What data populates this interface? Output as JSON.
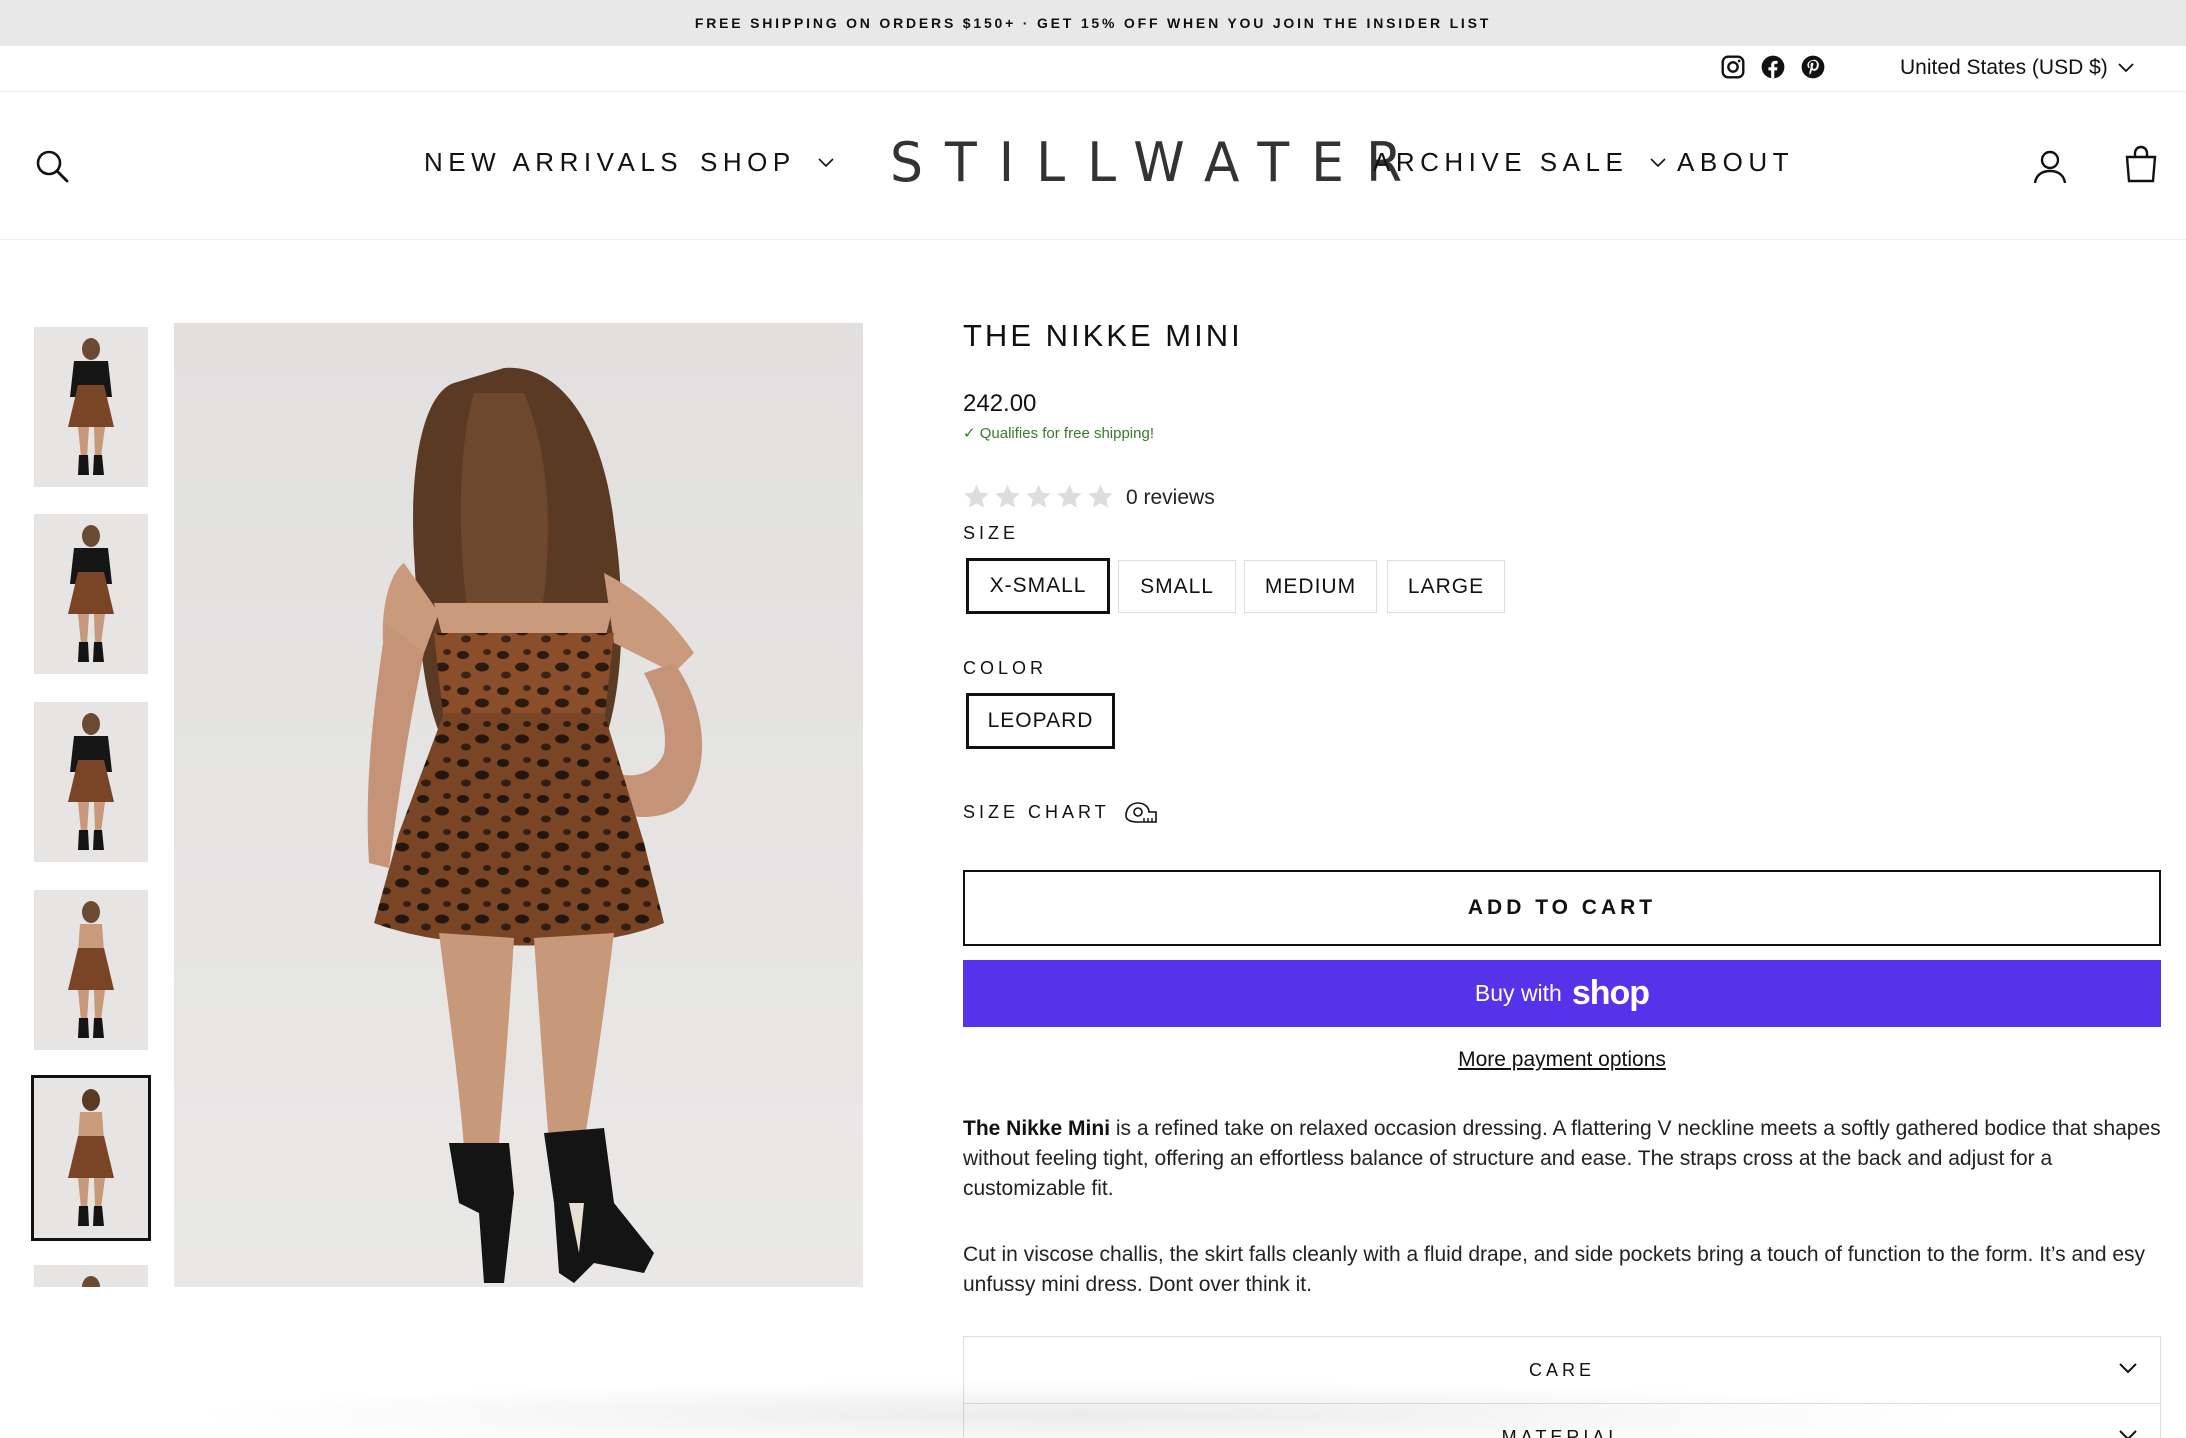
{
  "announcement": "FREE SHIPPING ON ORDERS $150+ · GET 15% OFF WHEN YOU JOIN THE INSIDER LIST",
  "utility": {
    "social": [
      "instagram-icon",
      "facebook-icon",
      "pinterest-icon"
    ],
    "currency": "United States (USD $)"
  },
  "header": {
    "logo": "STILLWATER",
    "nav_left": [
      {
        "label": "NEW ARRIVALS",
        "dropdown": false
      },
      {
        "label": "SHOP",
        "dropdown": true
      }
    ],
    "nav_right": [
      {
        "label": "ARCHIVE SALE",
        "dropdown": true
      },
      {
        "label": "ABOUT",
        "dropdown": false
      }
    ],
    "icons": [
      "search-icon",
      "account-icon",
      "cart-icon"
    ]
  },
  "gallery": {
    "thumbnail_count": 6,
    "active_index": 4
  },
  "product": {
    "title": "THE NIKKE MINI",
    "price": "242.00",
    "shipping_note": "✓ Qualifies for free shipping!",
    "rating": 0,
    "reviews": "0 reviews",
    "size_label": "SIZE",
    "sizes": [
      "X-SMALL",
      "SMALL",
      "MEDIUM",
      "LARGE"
    ],
    "selected_size": "X-SMALL",
    "color_label": "COLOR",
    "colors": [
      "LEOPARD"
    ],
    "selected_color": "LEOPARD",
    "size_chart": "SIZE CHART",
    "add_to_cart": "ADD TO CART",
    "buy_with": "Buy with",
    "shop_word": "shop",
    "more_payment": "More payment options",
    "desc_bold": "The Nikke Mini",
    "desc_1": " is a refined take on relaxed occasion dressing. A flattering V neckline meets a softly gathered bodice that shapes without feeling tight, offering an effortless balance of structure and ease. The straps cross at the back and adjust for a customizable fit.",
    "desc_2": "Cut in viscose challis, the skirt falls cleanly with a fluid drape, and side pockets bring a touch of function to the form. It’s and esy unfussy mini dress.  Dont over think it.",
    "accordions": [
      "CARE",
      "MATERIAL"
    ]
  },
  "colors": {
    "announce_bg": "#e8e8e8",
    "shop_pay": "#5433eb",
    "success": "#3a7a2c"
  }
}
